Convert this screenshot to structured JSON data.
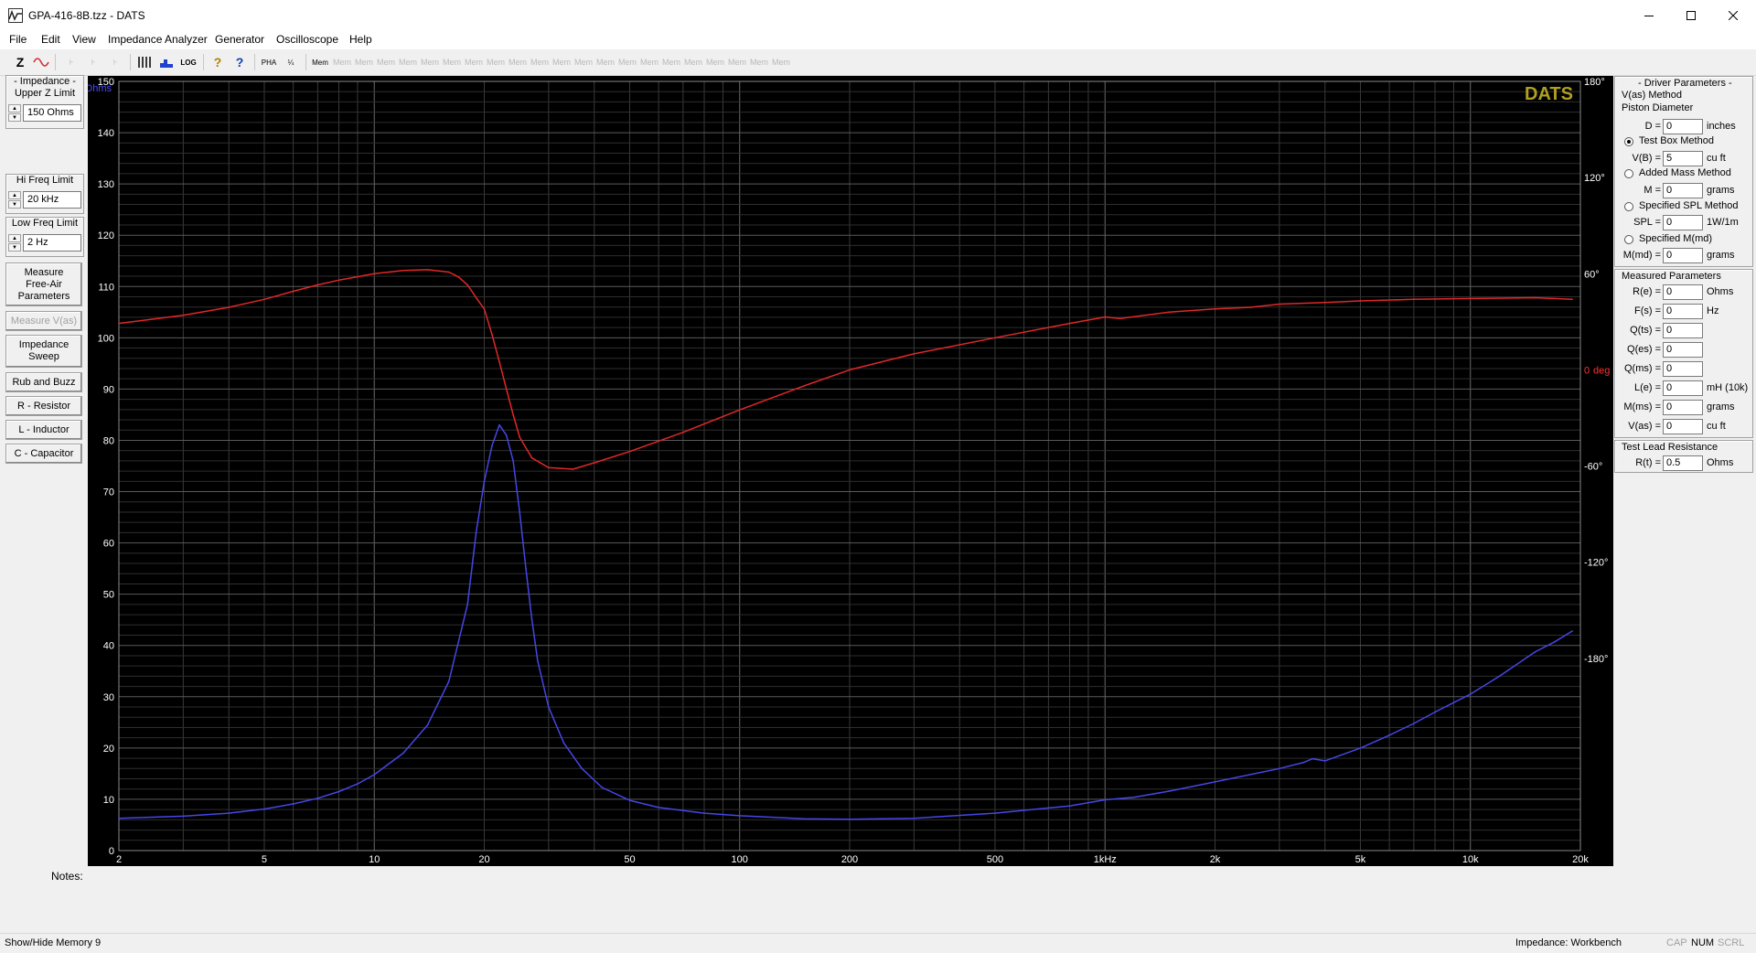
{
  "window": {
    "title": "GPA-416-8B.tzz - DATS"
  },
  "menu": [
    "File",
    "Edit",
    "View",
    "Impedance Analyzer",
    "Generator",
    "Oscilloscope",
    "Help"
  ],
  "toolbar": {
    "z_label": "Z",
    "mem_labels": [
      "Mem",
      "Mem",
      "Mem",
      "Mem",
      "Mem",
      "Mem",
      "Mem",
      "Mem",
      "Mem",
      "Mem",
      "Mem",
      "Mem",
      "Mem",
      "Mem",
      "Mem",
      "Mem",
      "Mem",
      "Mem",
      "Mem",
      "Mem",
      "Mem"
    ]
  },
  "left": {
    "impedance_caption": "- Impedance -",
    "upper_z_caption": "Upper Z Limit",
    "upper_z_value": "150 Ohms",
    "hi_freq_caption": "Hi Freq Limit",
    "hi_freq_value": "20 kHz",
    "low_freq_caption": "Low Freq Limit",
    "low_freq_value": "2 Hz",
    "btn_measure_free_air": "Measure Free-Air Parameters",
    "btn_measure_vas": "Measure V(as)",
    "btn_impedance_sweep": "Impedance Sweep",
    "btn_rub_buzz": "Rub and Buzz",
    "btn_resistor": "R - Resistor",
    "btn_inductor": "L - Inductor",
    "btn_capacitor": "C - Capacitor"
  },
  "chart_data": {
    "type": "line",
    "brand": "DATS",
    "x_scale": "log",
    "xlim": [
      2,
      20000
    ],
    "x_ticks": [
      2,
      5,
      10,
      20,
      50,
      100,
      200,
      500,
      1000,
      2000,
      5000,
      10000,
      20000
    ],
    "x_tick_labels": [
      "2",
      "5",
      "10",
      "20",
      "50",
      "100",
      "200",
      "500",
      "1kHz",
      "2k",
      "5k",
      "10k",
      "20k"
    ],
    "left_axis": {
      "label": "Ohms",
      "ylim": [
        0,
        150
      ],
      "ticks": [
        0,
        10,
        20,
        30,
        40,
        50,
        60,
        70,
        80,
        90,
        100,
        110,
        120,
        130,
        140,
        150
      ]
    },
    "right_axis": {
      "label": "deg",
      "zero_label": "0",
      "ylim": [
        -300,
        180
      ],
      "ticks": [
        180,
        120,
        60,
        0,
        -60,
        -120,
        -180
      ],
      "tick_labels": [
        "180°",
        "120°",
        "60°",
        "0",
        "-60°",
        "-120°",
        "-180°"
      ]
    },
    "grid": true,
    "series": [
      {
        "axis": "left",
        "color": "#4646e6",
        "points": [
          [
            2,
            6.3
          ],
          [
            3,
            6.7
          ],
          [
            4,
            7.3
          ],
          [
            5,
            8.1
          ],
          [
            6,
            9.1
          ],
          [
            7,
            10.2
          ],
          [
            8,
            11.5
          ],
          [
            9,
            13
          ],
          [
            10,
            14.8
          ],
          [
            12,
            19
          ],
          [
            14,
            24.5
          ],
          [
            16,
            33
          ],
          [
            18,
            48
          ],
          [
            19,
            62
          ],
          [
            20,
            72
          ],
          [
            21,
            79
          ],
          [
            22,
            83
          ],
          [
            23,
            81
          ],
          [
            24,
            76
          ],
          [
            25,
            66
          ],
          [
            26,
            55
          ],
          [
            27,
            45
          ],
          [
            28,
            37
          ],
          [
            30,
            28
          ],
          [
            33,
            21
          ],
          [
            37,
            16
          ],
          [
            42,
            12.3
          ],
          [
            50,
            9.8
          ],
          [
            60,
            8.4
          ],
          [
            80,
            7.3
          ],
          [
            100,
            6.8
          ],
          [
            150,
            6.2
          ],
          [
            200,
            6.1
          ],
          [
            300,
            6.3
          ],
          [
            500,
            7.3
          ],
          [
            800,
            8.7
          ],
          [
            1000,
            9.9
          ],
          [
            1200,
            10.4
          ],
          [
            1500,
            11.6
          ],
          [
            2000,
            13.4
          ],
          [
            3000,
            16
          ],
          [
            3500,
            17.2
          ],
          [
            3700,
            17.9
          ],
          [
            4000,
            17.5
          ],
          [
            5000,
            20
          ],
          [
            6000,
            22.5
          ],
          [
            7000,
            24.8
          ],
          [
            8000,
            27
          ],
          [
            10000,
            30.5
          ],
          [
            12000,
            34
          ],
          [
            15000,
            38.7
          ],
          [
            17000,
            40.7
          ],
          [
            19000,
            42.8
          ]
        ]
      },
      {
        "axis": "right",
        "color": "#e02828",
        "points": [
          [
            2,
            29
          ],
          [
            3,
            34
          ],
          [
            4,
            39
          ],
          [
            5,
            44
          ],
          [
            6,
            49
          ],
          [
            7,
            53
          ],
          [
            8,
            56
          ],
          [
            10,
            60
          ],
          [
            12,
            62
          ],
          [
            14,
            62.5
          ],
          [
            16,
            61
          ],
          [
            17,
            58
          ],
          [
            18,
            53
          ],
          [
            19,
            45
          ],
          [
            20,
            38
          ],
          [
            21,
            22
          ],
          [
            22,
            5
          ],
          [
            23,
            -12
          ],
          [
            24,
            -28
          ],
          [
            25,
            -42
          ],
          [
            27,
            -55
          ],
          [
            30,
            -61
          ],
          [
            35,
            -62
          ],
          [
            40,
            -58
          ],
          [
            50,
            -51
          ],
          [
            70,
            -39
          ],
          [
            100,
            -25
          ],
          [
            150,
            -10
          ],
          [
            200,
            0
          ],
          [
            300,
            10
          ],
          [
            500,
            20
          ],
          [
            800,
            29
          ],
          [
            1000,
            33
          ],
          [
            1100,
            32
          ],
          [
            1500,
            36
          ],
          [
            2000,
            38
          ],
          [
            2500,
            39
          ],
          [
            3000,
            41
          ],
          [
            4000,
            42
          ],
          [
            5000,
            43
          ],
          [
            7000,
            44
          ],
          [
            10000,
            44.5
          ],
          [
            15000,
            45
          ],
          [
            19000,
            44
          ]
        ]
      }
    ]
  },
  "driver": {
    "caption": "- Driver Parameters -",
    "vas_method": "V(as) Method",
    "piston_caption": "Piston Diameter",
    "d_label": "D =",
    "d_value": "0",
    "d_unit": "inches",
    "test_box": "Test Box Method",
    "vb_label": "V(B) =",
    "vb_value": "5",
    "vb_unit": "cu ft",
    "added_mass": "Added Mass Method",
    "m_label": "M =",
    "m_value": "0",
    "m_unit": "grams",
    "spl_method": "Specified SPL Method",
    "spl_label": "SPL =",
    "spl_value": "0",
    "spl_unit": "1W/1m",
    "mmd_method": "Specified M(md)",
    "mmd_label": "M(md) =",
    "mmd_value": "0",
    "mmd_unit": "grams"
  },
  "measured": {
    "caption": "Measured Parameters",
    "rows": [
      {
        "label": "R(e) =",
        "value": "0",
        "unit": "Ohms"
      },
      {
        "label": "F(s) =",
        "value": "0",
        "unit": "Hz"
      },
      {
        "label": "Q(ts) =",
        "value": "0",
        "unit": ""
      },
      {
        "label": "Q(es) =",
        "value": "0",
        "unit": ""
      },
      {
        "label": "Q(ms) =",
        "value": "0",
        "unit": ""
      },
      {
        "label": "L(e) =",
        "value": "0",
        "unit": "mH (10k)"
      },
      {
        "label": "M(ms) =",
        "value": "0",
        "unit": "grams"
      },
      {
        "label": "V(as) =",
        "value": "0",
        "unit": "cu ft"
      }
    ]
  },
  "lead": {
    "caption": "Test Lead Resistance",
    "label": "R(t) =",
    "value": "0.5",
    "unit": "Ohms"
  },
  "notes_label": "Notes:",
  "status": {
    "left": "Show/Hide Memory 9",
    "mode": "Impedance: Workbench",
    "cap": "CAP",
    "num": "NUM",
    "scrl": "SCRL"
  }
}
